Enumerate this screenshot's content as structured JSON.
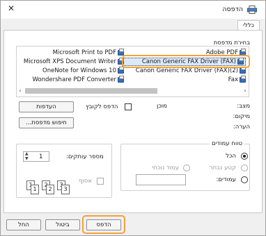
{
  "window": {
    "title": "הדפסה"
  },
  "tabs": [
    {
      "label": "כללי"
    }
  ],
  "select_printer": {
    "label": "בחירת מדפסת",
    "left_column": [
      "Microsoft Print to PDF",
      "Microsoft XPS Document Writer",
      "OneNote for Windows 10",
      "Wondershare PDF Converter"
    ],
    "right_column": [
      "Adobe PDF",
      "Canon Generic FAX Driver (FAX)",
      "Canon Generic FAX Driver (FAX)(2)",
      "Fax"
    ],
    "selected": "Canon Generic FAX Driver (FAX)"
  },
  "status": {
    "status_label": "מצב:",
    "status_value": "מוכן",
    "location_label": "מיקום:",
    "comment_label": "הערה:",
    "print_to_file_label": "הדפס לקובץ",
    "preferences_button": "העדפות",
    "find_printer_button": "חיפוש מדפסת..."
  },
  "page_range": {
    "label": "טווח עמודים",
    "all_label": "הכל",
    "selection_label": "קטע נבחר",
    "current_page_label": "עמוד נוכחי",
    "pages_label": "עמודים:"
  },
  "copies": {
    "label": "מספר עותקים:",
    "value": "1",
    "collate_label": "אסוף",
    "collate_icon_pages": [
      "1",
      "1",
      "2",
      "2",
      "3",
      "3"
    ]
  },
  "buttons": {
    "print": "הדפס",
    "cancel": "ביטול",
    "apply": "החל"
  },
  "icons": {
    "close": "close-icon",
    "printer": "printer-icon",
    "spinner": "spinner-icon"
  },
  "colors": {
    "highlight": "#f2a33a",
    "selection": "#dbe9f9"
  }
}
